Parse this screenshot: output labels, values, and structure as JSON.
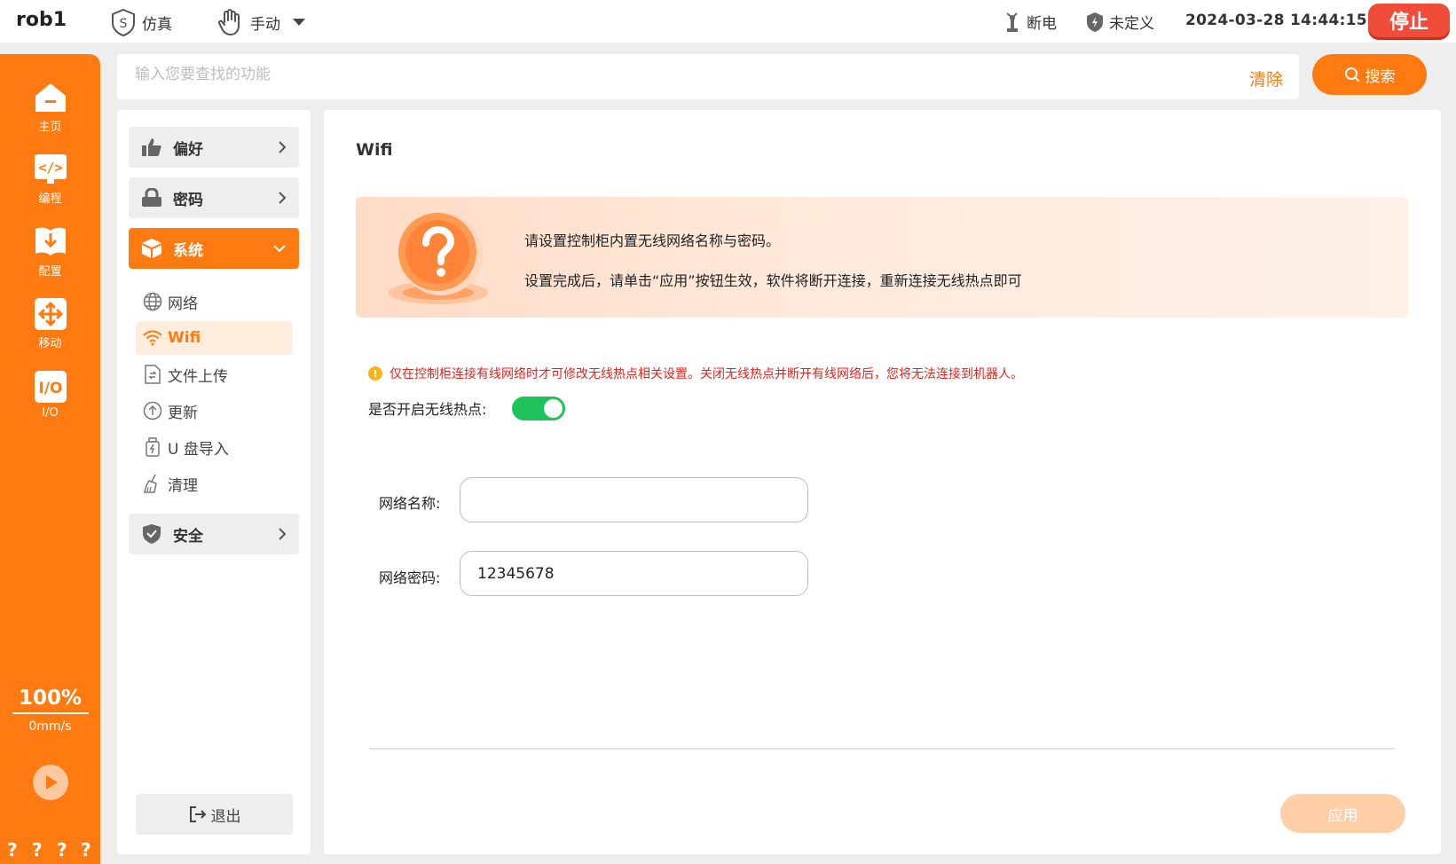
{
  "topbar": {
    "robot_name": "rob1",
    "mode_sim": "仿真",
    "mode_manual": "手动",
    "power_status": "断电",
    "safety_status": "未定义",
    "datetime": "2024-03-28 14:44:15",
    "stop_label": "停止"
  },
  "rail": {
    "items": [
      {
        "label": "主页",
        "icon": "home-icon"
      },
      {
        "label": "编程",
        "icon": "code-icon"
      },
      {
        "label": "配置",
        "icon": "config-icon"
      },
      {
        "label": "移动",
        "icon": "move-icon"
      },
      {
        "label": "I/O",
        "icon": "io-icon"
      }
    ],
    "speed_percent": "100%",
    "speed_value": "0mm/s",
    "help_marks": [
      "?",
      "?",
      "?",
      "?"
    ]
  },
  "search": {
    "placeholder": "输入您要查找的功能",
    "value": "",
    "clear_label": "清除",
    "button_label": "搜索"
  },
  "menu": {
    "groups": [
      {
        "label": "偏好",
        "icon": "thumbs-up-icon"
      },
      {
        "label": "密码",
        "icon": "lock-icon"
      },
      {
        "label": "系统",
        "icon": "cube-icon"
      },
      {
        "label": "安全",
        "icon": "shield-icon"
      }
    ],
    "system_items": [
      {
        "label": "网络",
        "icon": "globe-icon"
      },
      {
        "label": "Wifi",
        "icon": "wifi-icon"
      },
      {
        "label": "文件上传",
        "icon": "file-upload-icon"
      },
      {
        "label": "更新",
        "icon": "update-icon"
      },
      {
        "label": "U 盘导入",
        "icon": "usb-icon"
      },
      {
        "label": "清理",
        "icon": "broom-icon"
      }
    ],
    "logout_label": "退出"
  },
  "main": {
    "title": "Wifi",
    "banner_line1": "请设置控制柜内置无线网络名称与密码。",
    "banner_line2": "设置完成后，请单击“应用”按钮生效，软件将断开连接，重新连接无线热点即可",
    "warning": "仅在控制柜连接有线网络时才可修改无线热点相关设置。关闭无线热点并断开有线网络后，您将无法连接到机器人。",
    "hotspot_label": "是否开启无线热点:",
    "hotspot_enabled": true,
    "ssid_label": "网络名称:",
    "ssid_value": "",
    "password_label": "网络密码:",
    "password_value": "12345678",
    "apply_label": "应用"
  },
  "colors": {
    "accent": "#ff7a10",
    "stop": "#f04c3a",
    "toggle_on": "#1fc15a",
    "warning_text": "#e8231c"
  }
}
